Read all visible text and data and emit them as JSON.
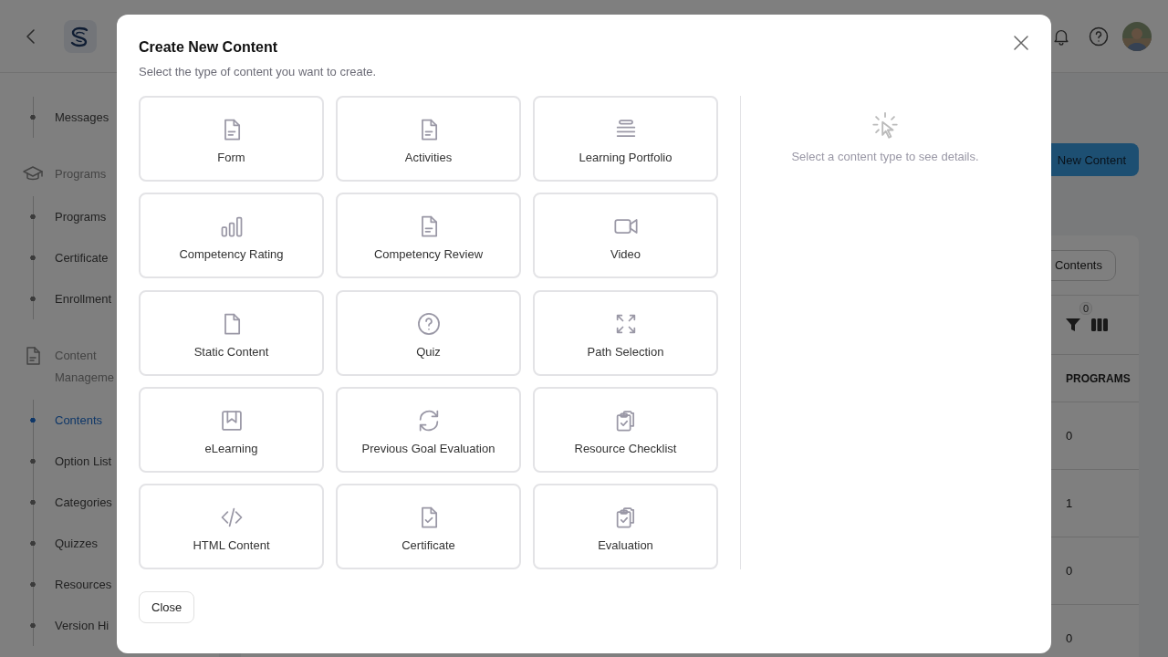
{
  "sidebar": {
    "sections": [
      {
        "items": [
          {
            "label": "Messages",
            "selected": false
          }
        ]
      },
      {
        "label": "Programs",
        "kind": "courses",
        "items": [
          {
            "label": "Programs",
            "selected": false
          },
          {
            "label": "Certificate",
            "selected": false
          },
          {
            "label": "Enrollment",
            "selected": false
          }
        ]
      },
      {
        "label": "Content Manageme",
        "kind": "documents",
        "items": [
          {
            "label": "Contents",
            "selected": true
          },
          {
            "label": "Option List",
            "selected": false
          },
          {
            "label": "Categories",
            "selected": false
          },
          {
            "label": "Quizzes",
            "selected": false
          },
          {
            "label": "Resources",
            "selected": false
          },
          {
            "label": "Version Hi",
            "selected": false
          }
        ]
      }
    ]
  },
  "main": {
    "new_button": "New Content",
    "contents_button": "Contents",
    "filter_count": "0",
    "table": {
      "columns": [
        "PROGRAMS"
      ],
      "rows": [
        [
          "0"
        ],
        [
          "1"
        ],
        [
          "0"
        ],
        [
          "0"
        ]
      ]
    }
  },
  "dialog": {
    "title": "Create New Content",
    "subtitle": "Select the type of content you want to create.",
    "options": [
      {
        "label": "Form",
        "kind": "document",
        "selected": false
      },
      {
        "label": "Activities",
        "kind": "document",
        "selected": false
      },
      {
        "label": "Learning Portfolio",
        "kind": "lines",
        "selected": false
      },
      {
        "label": "Competency Rating",
        "kind": "bars",
        "selected": false
      },
      {
        "label": "Competency Review",
        "kind": "document",
        "selected": false
      },
      {
        "label": "Video",
        "kind": "video",
        "selected": false
      },
      {
        "label": "Static Content",
        "kind": "page",
        "selected": false
      },
      {
        "label": "Quiz",
        "kind": "question",
        "selected": false
      },
      {
        "label": "Path Selection",
        "kind": "expand",
        "selected": false
      },
      {
        "label": "eLearning",
        "kind": "bookmark",
        "selected": false
      },
      {
        "label": "Previous Goal Evaluation",
        "kind": "refresh",
        "selected": false
      },
      {
        "label": "Resource Checklist",
        "kind": "clipboard",
        "selected": false
      },
      {
        "label": "HTML Content",
        "kind": "code",
        "selected": false
      },
      {
        "label": "Certificate",
        "kind": "certificate",
        "selected": false
      },
      {
        "label": "Evaluation",
        "kind": "clipboard",
        "selected": false
      }
    ],
    "details_hint": "Select a content type to see details.",
    "close_button": "Close"
  }
}
